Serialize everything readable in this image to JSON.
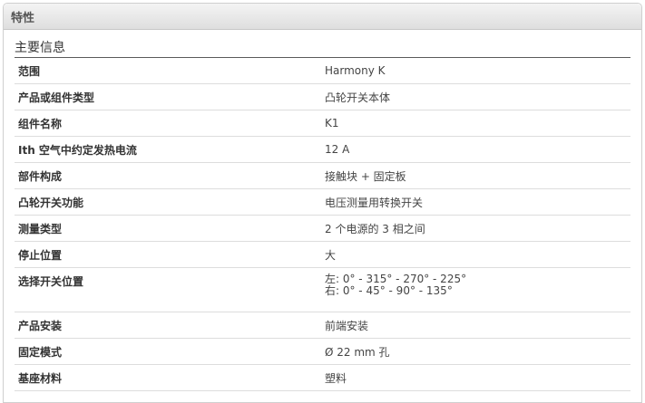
{
  "panel": {
    "title": "特性"
  },
  "section": {
    "title": "主要信息"
  },
  "rows": [
    {
      "label": "范围",
      "value": "Harmony K"
    },
    {
      "label": "产品或组件类型",
      "value": "凸轮开关本体"
    },
    {
      "label": "组件名称",
      "value": "K1"
    },
    {
      "label": "Ith 空气中约定发热电流",
      "value": "12 A"
    },
    {
      "label": "部件构成",
      "value": "接触块 + 固定板"
    },
    {
      "label": "凸轮开关功能",
      "value": "电压测量用转换开关"
    },
    {
      "label": "测量类型",
      "value": "2 个电源的 3 相之间"
    },
    {
      "label": "停止位置",
      "value": "大"
    },
    {
      "label": "选择开关位置",
      "value_lines": [
        "左: 0° - 315° - 270° - 225°",
        "右: 0° - 45° - 90° - 135°"
      ]
    },
    {
      "label": "产品安装",
      "value": "前端安装"
    },
    {
      "label": "固定模式",
      "value": "Ø 22 mm 孔"
    },
    {
      "label": "基座材料",
      "value": "塑料"
    }
  ]
}
